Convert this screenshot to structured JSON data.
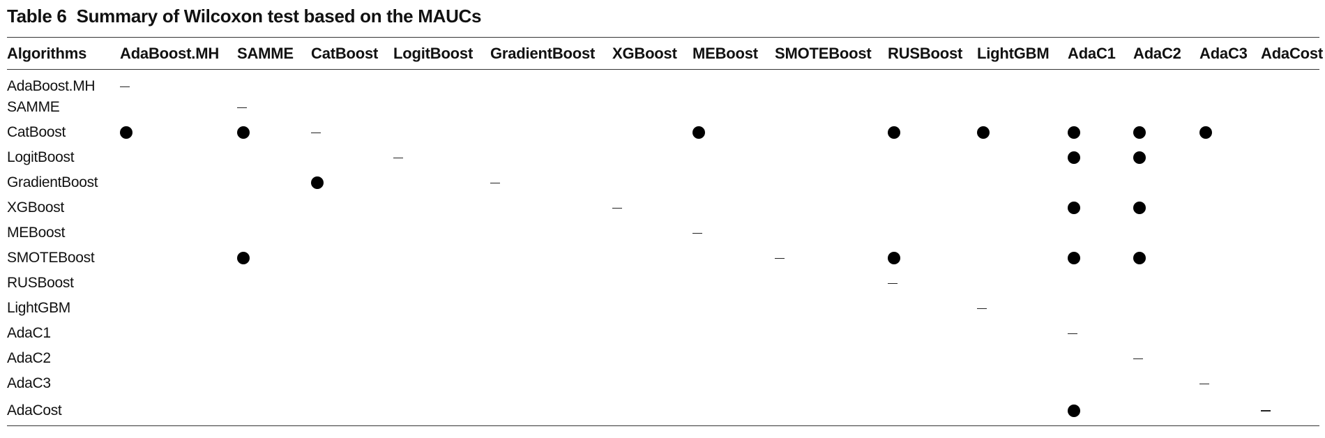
{
  "caption": {
    "label": "Table 6",
    "title": "Summary of Wilcoxon test based on the MAUCs"
  },
  "header": {
    "row_label": "Algorithms",
    "columns": [
      "AdaBoost.MH",
      "SAMME",
      "CatBoost",
      "LogitBoost",
      "GradientBoost",
      "XGBoost",
      "MEBoost",
      "SMOTEBoost",
      "RUSBoost",
      "LightGBM",
      "AdaC1",
      "AdaC2",
      "AdaC3",
      "AdaCost"
    ]
  },
  "legend": {
    "dash": "–",
    "dot": "●"
  },
  "rows": [
    {
      "name": "AdaBoost.MH",
      "cells": [
        "–",
        "",
        "",
        "",
        "",
        "",
        "",
        "",
        "",
        "",
        "",
        "",
        "",
        ""
      ]
    },
    {
      "name": "SAMME",
      "cells": [
        "",
        "–",
        "",
        "",
        "",
        "",
        "",
        "",
        "",
        "",
        "",
        "",
        "",
        ""
      ]
    },
    {
      "name": "CatBoost",
      "cells": [
        "●",
        "●",
        "–",
        "",
        "",
        "",
        "●",
        "",
        "●",
        "●",
        "●",
        "●",
        "●",
        ""
      ]
    },
    {
      "name": "LogitBoost",
      "cells": [
        "",
        "",
        "",
        "–",
        "",
        "",
        "",
        "",
        "",
        "",
        "●",
        "●",
        "",
        ""
      ]
    },
    {
      "name": "GradientBoost",
      "cells": [
        "",
        "",
        "●",
        "",
        "–",
        "",
        "",
        "",
        "",
        "",
        "",
        "",
        "",
        ""
      ]
    },
    {
      "name": "XGBoost",
      "cells": [
        "",
        "",
        "",
        "",
        "",
        "–",
        "",
        "",
        "",
        "",
        "●",
        "●",
        "",
        ""
      ]
    },
    {
      "name": "MEBoost",
      "cells": [
        "",
        "",
        "",
        "",
        "",
        "",
        "–",
        "",
        "",
        "",
        "",
        "",
        "",
        ""
      ]
    },
    {
      "name": "SMOTEBoost",
      "cells": [
        "",
        "●",
        "",
        "",
        "",
        "",
        "",
        "–",
        "●",
        "",
        "●",
        "●",
        "",
        ""
      ]
    },
    {
      "name": "RUSBoost",
      "cells": [
        "",
        "",
        "",
        "",
        "",
        "",
        "",
        "",
        "–",
        "",
        "",
        "",
        "",
        ""
      ]
    },
    {
      "name": "LightGBM",
      "cells": [
        "",
        "",
        "",
        "",
        "",
        "",
        "",
        "",
        "",
        "–",
        "",
        "",
        "",
        ""
      ]
    },
    {
      "name": "AdaC1",
      "cells": [
        "",
        "",
        "",
        "",
        "",
        "",
        "",
        "",
        "",
        "",
        "–",
        "",
        "",
        ""
      ]
    },
    {
      "name": "AdaC2",
      "cells": [
        "",
        "",
        "",
        "",
        "",
        "",
        "",
        "",
        "",
        "",
        "",
        "–",
        "",
        ""
      ]
    },
    {
      "name": "AdaC3",
      "cells": [
        "",
        "",
        "",
        "",
        "",
        "",
        "",
        "",
        "",
        "",
        "",
        "",
        "–",
        ""
      ]
    },
    {
      "name": "AdaCost",
      "cells": [
        "",
        "",
        "",
        "",
        "",
        "",
        "",
        "",
        "",
        "",
        "●",
        "",
        "",
        "–"
      ]
    }
  ]
}
